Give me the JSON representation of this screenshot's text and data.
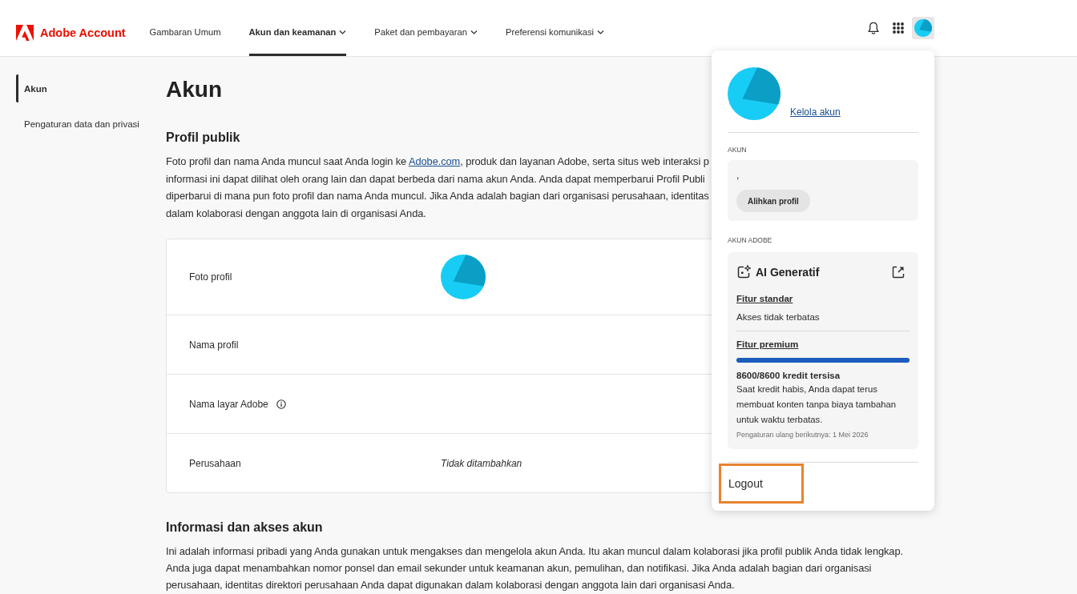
{
  "header": {
    "brand": "Adobe Account",
    "nav": [
      {
        "label": "Gambaran Umum",
        "selected": false,
        "dropdown": false
      },
      {
        "label": "Akun dan keamanan",
        "selected": true,
        "dropdown": true
      },
      {
        "label": "Paket dan pembayaran",
        "selected": false,
        "dropdown": true
      },
      {
        "label": "Preferensi komunikasi",
        "selected": false,
        "dropdown": true
      }
    ]
  },
  "sidebar": {
    "items": [
      {
        "label": "Akun",
        "selected": true
      },
      {
        "label": "Pengaturan data dan privasi",
        "selected": false
      }
    ]
  },
  "page": {
    "title": "Akun",
    "public_profile": {
      "heading": "Profil publik",
      "description_lines": [
        [
          {
            "kind": "text",
            "text": "Foto profil dan nama Anda muncul saat Anda login ke "
          },
          {
            "kind": "link",
            "text": "Adobe.com"
          },
          {
            "kind": "text",
            "text": ", produk dan layanan Adobe, serta situs web interaksi p"
          }
        ],
        [
          {
            "kind": "text",
            "text": "informasi ini dapat dilihat oleh orang lain dan dapat berbeda dari nama akun Anda. Anda dapat memperbarui Profil Publi"
          }
        ],
        [
          {
            "kind": "text",
            "text": "diperbarui di mana pun foto profil dan nama Anda muncul. Jika Anda adalah bagian dari organisasi perusahaan, identitas"
          }
        ],
        [
          {
            "kind": "text",
            "text": "dalam kolaborasi dengan anggota lain di organisasi Anda."
          }
        ]
      ],
      "rows": [
        {
          "label": "Foto profil",
          "kind": "photo",
          "info": false
        },
        {
          "label": "Nama profil",
          "kind": "empty",
          "info": false
        },
        {
          "label": "Nama layar Adobe",
          "kind": "empty",
          "info": true
        },
        {
          "label": "Perusahaan",
          "kind": "text",
          "value": "Tidak ditambahkan",
          "info": false
        }
      ]
    },
    "account_info": {
      "heading": "Informasi dan akses akun",
      "description_lines": [
        "Ini adalah informasi pribadi yang Anda gunakan untuk mengakses dan mengelola akun Anda. Itu akan muncul dalam kolaborasi jika profil publik Anda tidak lengkap.",
        "Anda juga dapat menambahkan nomor ponsel dan email sekunder untuk keamanan akun, pemulihan, dan notifikasi. Jika Anda adalah bagian dari organisasi",
        "perusahaan, identitas direktori perusahaan Anda dapat digunakan dalam kolaborasi dengan anggota lain dari organisasi Anda."
      ]
    }
  },
  "account_menu": {
    "manage_link": "Kelola akun",
    "account": {
      "heading": "AKUN",
      "name": ",",
      "switch_button": "Alihkan profil"
    },
    "adobe_account": {
      "heading": "AKUN ADOBE",
      "title": "AI Generatif",
      "standard": {
        "title": "Fitur standar",
        "text": "Akses tidak terbatas"
      },
      "premium": {
        "title": "Fitur premium",
        "level": 1,
        "credits": "8600/8600 kredit tersisa",
        "note": "Saat kredit habis, Anda dapat terus membuat konten tanpa biaya tambahan untuk waktu terbatas.",
        "reset": "Pengaturan ulang berikutnya: 1 Mei 2026"
      }
    },
    "logout": {
      "label": "Logout",
      "highlighted": true
    }
  }
}
